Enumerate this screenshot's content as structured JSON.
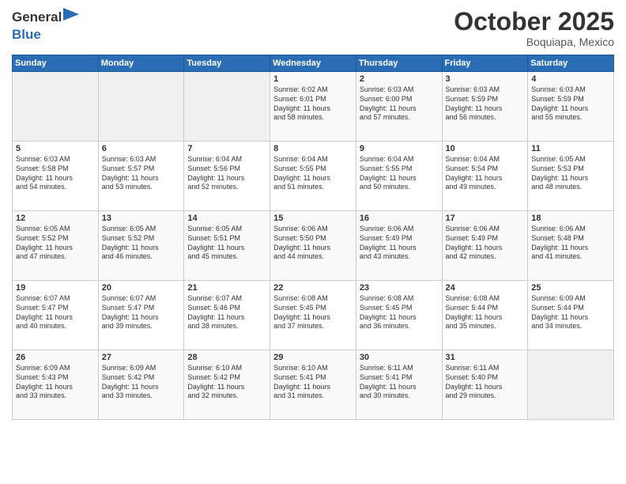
{
  "header": {
    "logo_line1": "General",
    "logo_line2": "Blue",
    "month": "October 2025",
    "location": "Boquiapa, Mexico"
  },
  "weekdays": [
    "Sunday",
    "Monday",
    "Tuesday",
    "Wednesday",
    "Thursday",
    "Friday",
    "Saturday"
  ],
  "weeks": [
    [
      {
        "day": "",
        "content": ""
      },
      {
        "day": "",
        "content": ""
      },
      {
        "day": "",
        "content": ""
      },
      {
        "day": "1",
        "content": "Sunrise: 6:02 AM\nSunset: 6:01 PM\nDaylight: 11 hours\nand 58 minutes."
      },
      {
        "day": "2",
        "content": "Sunrise: 6:03 AM\nSunset: 6:00 PM\nDaylight: 11 hours\nand 57 minutes."
      },
      {
        "day": "3",
        "content": "Sunrise: 6:03 AM\nSunset: 5:59 PM\nDaylight: 11 hours\nand 56 minutes."
      },
      {
        "day": "4",
        "content": "Sunrise: 6:03 AM\nSunset: 5:59 PM\nDaylight: 11 hours\nand 55 minutes."
      }
    ],
    [
      {
        "day": "5",
        "content": "Sunrise: 6:03 AM\nSunset: 5:58 PM\nDaylight: 11 hours\nand 54 minutes."
      },
      {
        "day": "6",
        "content": "Sunrise: 6:03 AM\nSunset: 5:57 PM\nDaylight: 11 hours\nand 53 minutes."
      },
      {
        "day": "7",
        "content": "Sunrise: 6:04 AM\nSunset: 5:56 PM\nDaylight: 11 hours\nand 52 minutes."
      },
      {
        "day": "8",
        "content": "Sunrise: 6:04 AM\nSunset: 5:55 PM\nDaylight: 11 hours\nand 51 minutes."
      },
      {
        "day": "9",
        "content": "Sunrise: 6:04 AM\nSunset: 5:55 PM\nDaylight: 11 hours\nand 50 minutes."
      },
      {
        "day": "10",
        "content": "Sunrise: 6:04 AM\nSunset: 5:54 PM\nDaylight: 11 hours\nand 49 minutes."
      },
      {
        "day": "11",
        "content": "Sunrise: 6:05 AM\nSunset: 5:53 PM\nDaylight: 11 hours\nand 48 minutes."
      }
    ],
    [
      {
        "day": "12",
        "content": "Sunrise: 6:05 AM\nSunset: 5:52 PM\nDaylight: 11 hours\nand 47 minutes."
      },
      {
        "day": "13",
        "content": "Sunrise: 6:05 AM\nSunset: 5:52 PM\nDaylight: 11 hours\nand 46 minutes."
      },
      {
        "day": "14",
        "content": "Sunrise: 6:05 AM\nSunset: 5:51 PM\nDaylight: 11 hours\nand 45 minutes."
      },
      {
        "day": "15",
        "content": "Sunrise: 6:06 AM\nSunset: 5:50 PM\nDaylight: 11 hours\nand 44 minutes."
      },
      {
        "day": "16",
        "content": "Sunrise: 6:06 AM\nSunset: 5:49 PM\nDaylight: 11 hours\nand 43 minutes."
      },
      {
        "day": "17",
        "content": "Sunrise: 6:06 AM\nSunset: 5:49 PM\nDaylight: 11 hours\nand 42 minutes."
      },
      {
        "day": "18",
        "content": "Sunrise: 6:06 AM\nSunset: 5:48 PM\nDaylight: 11 hours\nand 41 minutes."
      }
    ],
    [
      {
        "day": "19",
        "content": "Sunrise: 6:07 AM\nSunset: 5:47 PM\nDaylight: 11 hours\nand 40 minutes."
      },
      {
        "day": "20",
        "content": "Sunrise: 6:07 AM\nSunset: 5:47 PM\nDaylight: 11 hours\nand 39 minutes."
      },
      {
        "day": "21",
        "content": "Sunrise: 6:07 AM\nSunset: 5:46 PM\nDaylight: 11 hours\nand 38 minutes."
      },
      {
        "day": "22",
        "content": "Sunrise: 6:08 AM\nSunset: 5:45 PM\nDaylight: 11 hours\nand 37 minutes."
      },
      {
        "day": "23",
        "content": "Sunrise: 6:08 AM\nSunset: 5:45 PM\nDaylight: 11 hours\nand 36 minutes."
      },
      {
        "day": "24",
        "content": "Sunrise: 6:08 AM\nSunset: 5:44 PM\nDaylight: 11 hours\nand 35 minutes."
      },
      {
        "day": "25",
        "content": "Sunrise: 6:09 AM\nSunset: 5:44 PM\nDaylight: 11 hours\nand 34 minutes."
      }
    ],
    [
      {
        "day": "26",
        "content": "Sunrise: 6:09 AM\nSunset: 5:43 PM\nDaylight: 11 hours\nand 33 minutes."
      },
      {
        "day": "27",
        "content": "Sunrise: 6:09 AM\nSunset: 5:42 PM\nDaylight: 11 hours\nand 33 minutes."
      },
      {
        "day": "28",
        "content": "Sunrise: 6:10 AM\nSunset: 5:42 PM\nDaylight: 11 hours\nand 32 minutes."
      },
      {
        "day": "29",
        "content": "Sunrise: 6:10 AM\nSunset: 5:41 PM\nDaylight: 11 hours\nand 31 minutes."
      },
      {
        "day": "30",
        "content": "Sunrise: 6:11 AM\nSunset: 5:41 PM\nDaylight: 11 hours\nand 30 minutes."
      },
      {
        "day": "31",
        "content": "Sunrise: 6:11 AM\nSunset: 5:40 PM\nDaylight: 11 hours\nand 29 minutes."
      },
      {
        "day": "",
        "content": ""
      }
    ]
  ]
}
